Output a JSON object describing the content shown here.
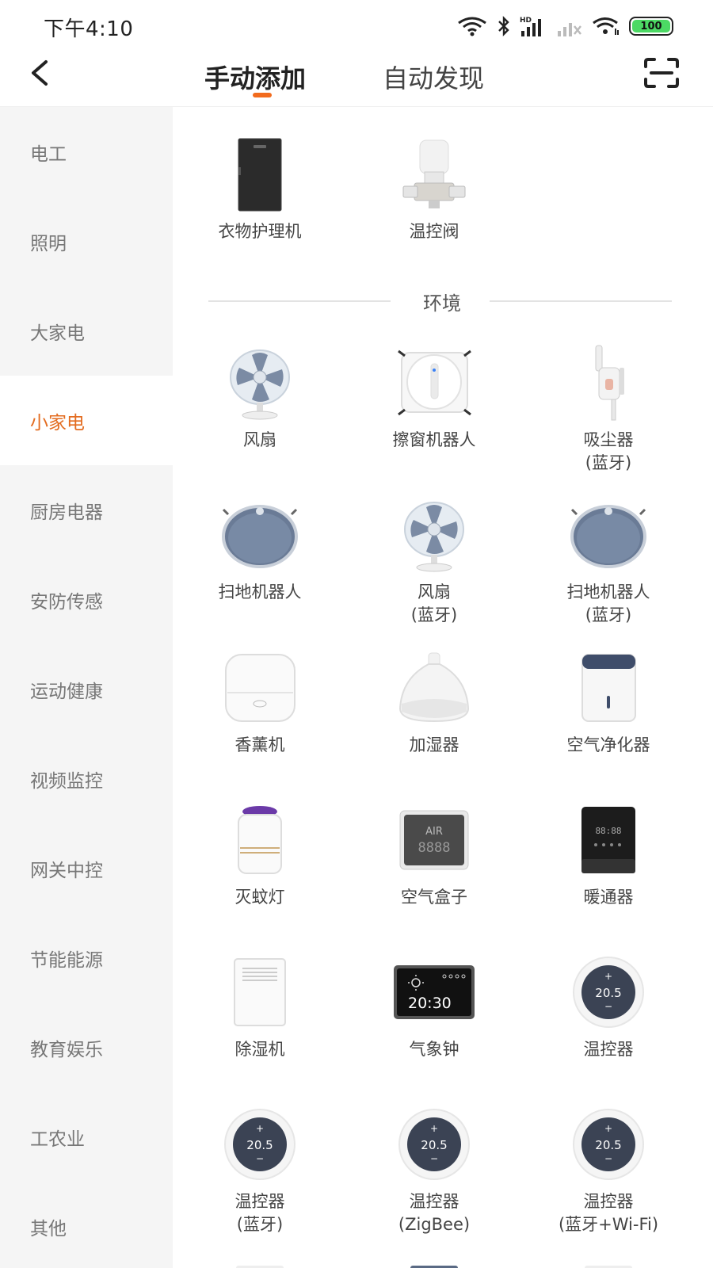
{
  "status": {
    "time": "下午4:10",
    "battery": "100"
  },
  "header": {
    "tabs": [
      "手动添加",
      "自动发现"
    ],
    "active_tab": 0
  },
  "sidebar": {
    "items": [
      {
        "label": "电工"
      },
      {
        "label": "照明"
      },
      {
        "label": "大家电"
      },
      {
        "label": "小家电",
        "active": true
      },
      {
        "label": "厨房电器"
      },
      {
        "label": "安防传感"
      },
      {
        "label": "运动健康"
      },
      {
        "label": "视频监控"
      },
      {
        "label": "网关中控"
      },
      {
        "label": "节能能源"
      },
      {
        "label": "教育娱乐"
      },
      {
        "label": "工农业"
      },
      {
        "label": "其他"
      }
    ]
  },
  "content": {
    "top_devices": [
      {
        "name": "衣物护理机",
        "icon": "wardrobe-icon"
      },
      {
        "name": "温控阀",
        "icon": "valve-icon"
      }
    ],
    "section": {
      "title": "环境"
    },
    "devices": [
      {
        "name": "风扇",
        "sub": "",
        "icon": "fan-icon"
      },
      {
        "name": "擦窗机器人",
        "sub": "",
        "icon": "window-robot-icon"
      },
      {
        "name": "吸尘器",
        "sub": "(蓝牙)",
        "icon": "vacuum-icon"
      },
      {
        "name": "扫地机器人",
        "sub": "",
        "icon": "robot-vacuum-icon"
      },
      {
        "name": "风扇",
        "sub": "(蓝牙)",
        "icon": "fan-icon"
      },
      {
        "name": "扫地机器人",
        "sub": "(蓝牙)",
        "icon": "robot-vacuum-icon"
      },
      {
        "name": "香薰机",
        "sub": "",
        "icon": "aroma-icon"
      },
      {
        "name": "加湿器",
        "sub": "",
        "icon": "humidifier-icon"
      },
      {
        "name": "空气净化器",
        "sub": "",
        "icon": "purifier-icon"
      },
      {
        "name": "灭蚊灯",
        "sub": "",
        "icon": "mosquito-lamp-icon"
      },
      {
        "name": "空气盒子",
        "sub": "",
        "icon": "air-box-icon"
      },
      {
        "name": "暖通器",
        "sub": "",
        "icon": "hvac-icon"
      },
      {
        "name": "除湿机",
        "sub": "",
        "icon": "dehumidifier-icon"
      },
      {
        "name": "气象钟",
        "sub": "",
        "icon": "weather-clock-icon"
      },
      {
        "name": "温控器",
        "sub": "",
        "icon": "thermostat-icon"
      },
      {
        "name": "温控器",
        "sub": "(蓝牙)",
        "icon": "thermostat-icon"
      },
      {
        "name": "温控器",
        "sub": "(ZigBee)",
        "icon": "thermostat-icon"
      },
      {
        "name": "温控器",
        "sub": "(蓝牙+Wi-Fi)",
        "icon": "thermostat-icon"
      }
    ],
    "air_box_text": "AIR",
    "air_box_digits": "8888",
    "weather_clock_time": "20:30",
    "thermostat_value": "20.5",
    "hvac_digits": "88:88"
  },
  "colors": {
    "accent": "#e36c20",
    "sidebar_bg": "#f5f5f5"
  }
}
